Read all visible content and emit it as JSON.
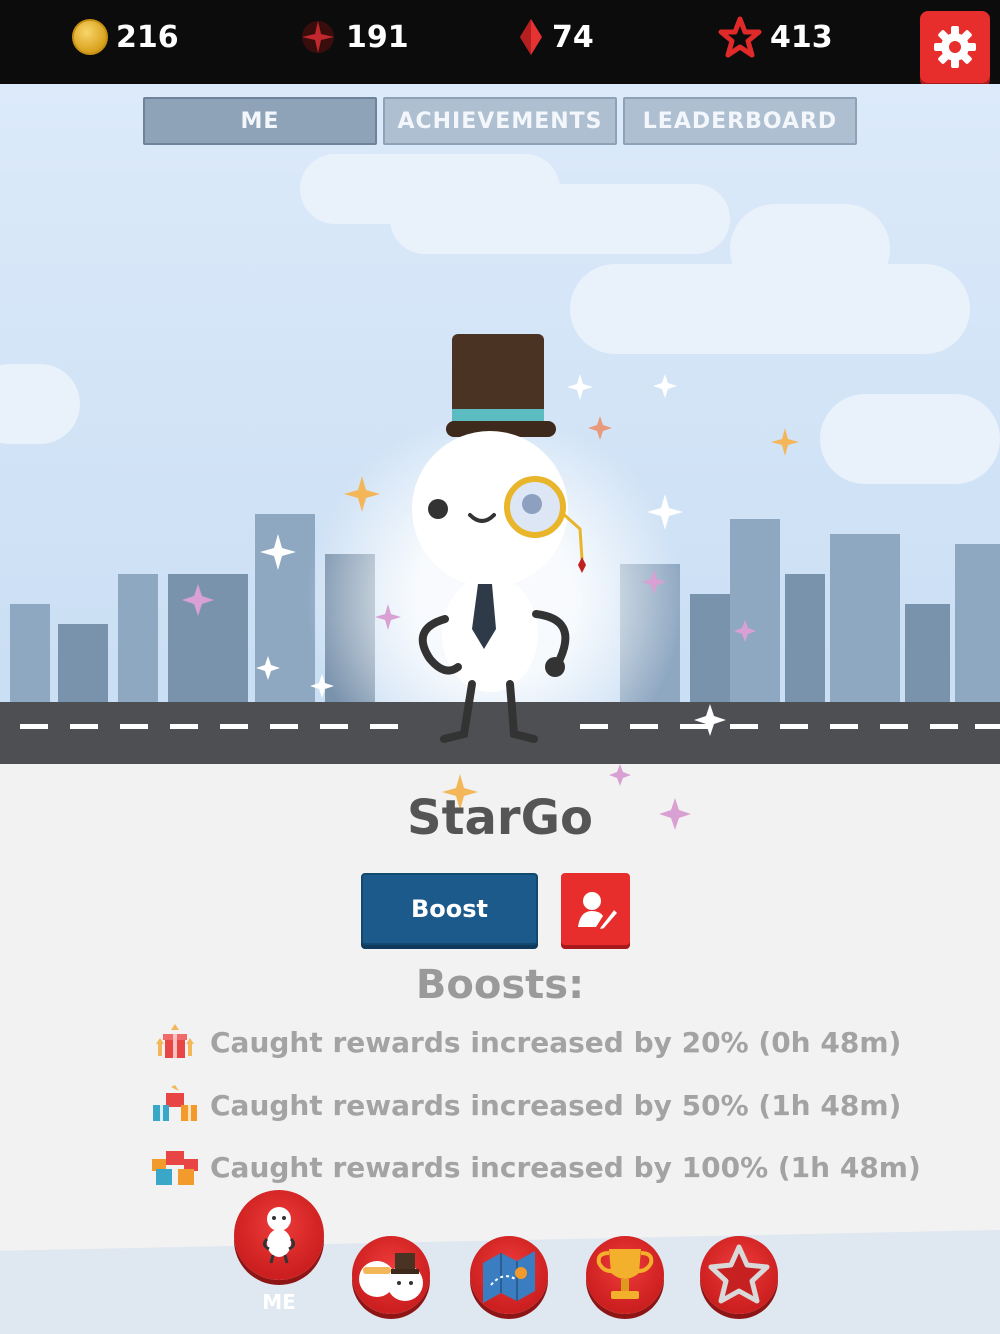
{
  "stats": {
    "coins": "216",
    "dark_stars": "191",
    "gems": "74",
    "stars": "413"
  },
  "icons": {
    "coin": "coin-icon",
    "dark_star": "dark-star-icon",
    "gem": "red-gem-icon",
    "star": "red-star-outline-icon",
    "settings": "gear-icon",
    "edit_profile": "edit-profile-icon",
    "gift": "gift-icon"
  },
  "tabs": [
    {
      "label": "ME",
      "active": true
    },
    {
      "label": "ACHIEVEMENTS",
      "active": false
    },
    {
      "label": "LEADERBOARD",
      "active": false
    }
  ],
  "player": {
    "name": "StarGo"
  },
  "actions": {
    "boost_label": "Boost"
  },
  "boosts": {
    "title": "Boosts:",
    "items": [
      {
        "text": "Caught rewards increased by 20% (0h 48m)"
      },
      {
        "text": "Caught rewards increased by 50% (1h 48m)"
      },
      {
        "text": "Caught rewards increased by 100% (1h 48m)"
      }
    ]
  },
  "bottom_nav": {
    "items": [
      {
        "name": "me",
        "label": "ME",
        "active": true
      },
      {
        "name": "characters",
        "label": "",
        "active": false
      },
      {
        "name": "map",
        "label": "",
        "active": false
      },
      {
        "name": "trophy",
        "label": "",
        "active": false
      },
      {
        "name": "star",
        "label": "",
        "active": false
      }
    ]
  },
  "colors": {
    "accent_red": "#e82d2d",
    "boost_blue": "#1c5a8c",
    "topbar": "#0c0c0c"
  }
}
